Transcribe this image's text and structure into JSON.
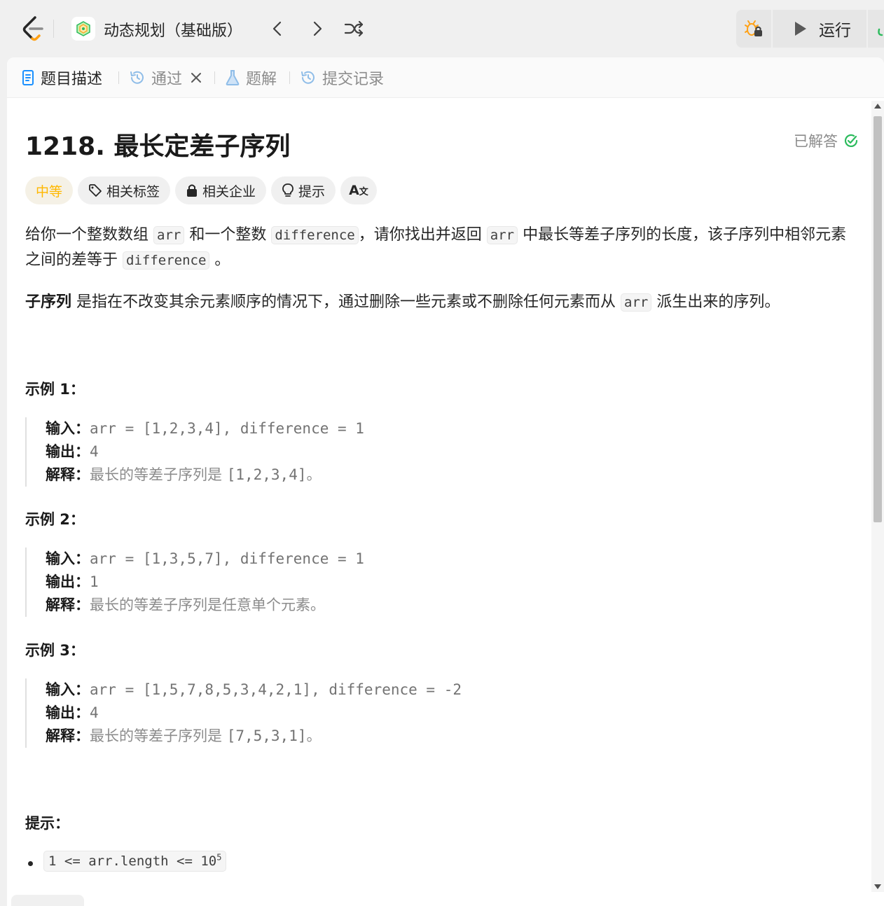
{
  "topbar": {
    "study_plan_title": "动态规划（基础版）",
    "run_label": "运行",
    "colors": {
      "logo_orange": "#ffa116",
      "run_bg": "#e6e6e6",
      "success_green": "#2cbb5d"
    }
  },
  "tabs": [
    {
      "label": "题目描述"
    },
    {
      "label": "通过"
    },
    {
      "label": "题解"
    },
    {
      "label": "提交记录"
    }
  ],
  "problem": {
    "title": "1218. 最长定差子序列",
    "status": "已解答",
    "difficulty": "中等",
    "tags": [
      "相关标签",
      "相关企业",
      "提示"
    ],
    "translate_icon_text": "A",
    "desc_p1_a": "给你一个整数数组",
    "desc_p1_code1": "arr",
    "desc_p1_b": "和一个整数",
    "desc_p1_code2": "difference",
    "desc_p1_c": "，请你找出并返回",
    "desc_p1_code3": "arr",
    "desc_p1_d": "中最长等差子序列的长度，该子序列中相邻元素之间的差等于",
    "desc_p1_code4": "difference",
    "desc_p1_e": "。",
    "desc_p2_bold": "子序列",
    "desc_p2_a": "是指在不改变其余元素顺序的情况下，通过删除一些元素或不删除任何元素而从",
    "desc_p2_code": "arr",
    "desc_p2_b": "派生出来的序列。"
  },
  "examples": [
    {
      "title": "示例 1：",
      "input_label": "输入：",
      "input": "arr = [1,2,3,4], difference = 1",
      "output_label": "输出：",
      "output": "4",
      "explain_label": "解释：",
      "explain_text": "最长的等差子序列是 ",
      "explain_code": "[1,2,3,4]",
      "explain_end": "。"
    },
    {
      "title": "示例 2：",
      "input_label": "输入：",
      "input": "arr = [1,3,5,7], difference = 1",
      "output_label": "输出：",
      "output": "1",
      "explain_label": "解释：",
      "explain_text": "最长的等差子序列是任意单个元素。",
      "explain_code": "",
      "explain_end": ""
    },
    {
      "title": "示例 3：",
      "input_label": "输入：",
      "input": "arr = [1,5,7,8,5,3,4,2,1], difference = -2",
      "output_label": "输出：",
      "output": "4",
      "explain_label": "解释：",
      "explain_text": "最长的等差子序列是 ",
      "explain_code": "[7,5,3,1]",
      "explain_end": "。"
    }
  ],
  "hints": {
    "title": "提示：",
    "constraint_1_base": "1 <= arr.length <= 10",
    "constraint_1_sup": "5"
  }
}
